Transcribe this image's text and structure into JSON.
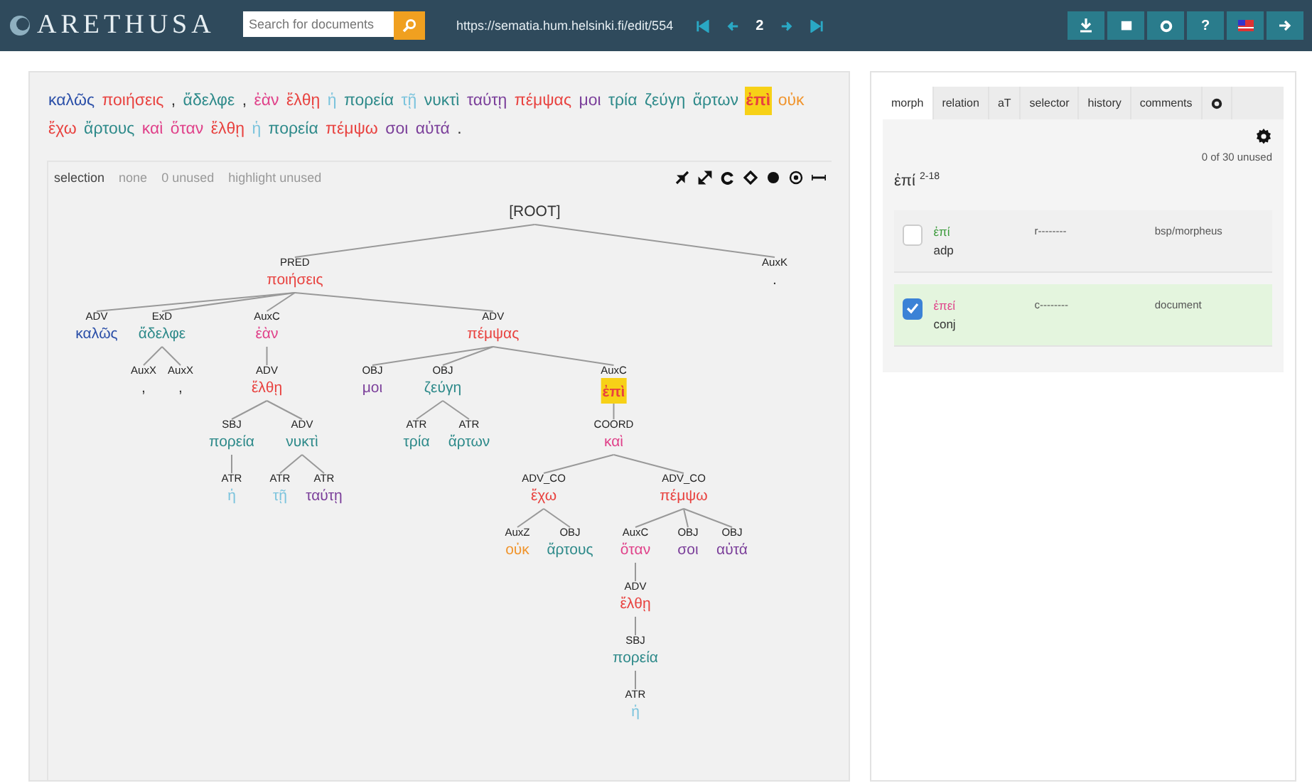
{
  "header": {
    "logo": "ARETHUSA",
    "search": {
      "placeholder": "Search for documents"
    },
    "url": "https://sematia.hum.helsinki.fi/edit/554",
    "page": "2",
    "help": "?"
  },
  "sentence": [
    {
      "text": "καλῶς",
      "color": "#2b4fa8",
      "highlighted": false
    },
    {
      "text": "ποιήσεις",
      "color": "#e8423f",
      "highlighted": false
    },
    {
      "text": ",",
      "color": "#333333",
      "highlighted": false
    },
    {
      "text": "ἄδελφε",
      "color": "#2e8a8a",
      "highlighted": false
    },
    {
      "text": ",",
      "color": "#333333",
      "highlighted": false
    },
    {
      "text": "ἐὰν",
      "color": "#e0428a",
      "highlighted": false
    },
    {
      "text": "ἔλθῃ",
      "color": "#e8423f",
      "highlighted": false
    },
    {
      "text": "ἡ",
      "color": "#7cc4dd",
      "highlighted": false
    },
    {
      "text": "πορεία",
      "color": "#2e8a8a",
      "highlighted": false
    },
    {
      "text": "τῇ",
      "color": "#7cc4dd",
      "highlighted": false
    },
    {
      "text": "νυκτὶ",
      "color": "#2e8a8a",
      "highlighted": false
    },
    {
      "text": "ταύτῃ",
      "color": "#7b3f9a",
      "highlighted": false
    },
    {
      "text": "πέμψας",
      "color": "#e8423f",
      "highlighted": false
    },
    {
      "text": "μοι",
      "color": "#7b3f9a",
      "highlighted": false
    },
    {
      "text": "τρία",
      "color": "#2e8a8a",
      "highlighted": false
    },
    {
      "text": "ζεύγη",
      "color": "#2e8a8a",
      "highlighted": false
    },
    {
      "text": "ἄρτων",
      "color": "#2e8a8a",
      "highlighted": false
    },
    {
      "text": "ἐπὶ",
      "color": "#e8423f",
      "highlighted": true
    },
    {
      "text": "οὐκ",
      "color": "#f0952e",
      "highlighted": false
    },
    {
      "text": "ἔχω",
      "color": "#e8423f",
      "highlighted": false
    },
    {
      "text": "ἄρτους",
      "color": "#2e8a8a",
      "highlighted": false
    },
    {
      "text": "καὶ",
      "color": "#e0428a",
      "highlighted": false
    },
    {
      "text": "ὅταν",
      "color": "#e0428a",
      "highlighted": false
    },
    {
      "text": "ἔλθῃ",
      "color": "#e8423f",
      "highlighted": false
    },
    {
      "text": "ἡ",
      "color": "#7cc4dd",
      "highlighted": false
    },
    {
      "text": "πορεία",
      "color": "#2e8a8a",
      "highlighted": false
    },
    {
      "text": "πέμψω",
      "color": "#e8423f",
      "highlighted": false
    },
    {
      "text": "σοι",
      "color": "#7b3f9a",
      "highlighted": false
    },
    {
      "text": "αὐτά",
      "color": "#7b3f9a",
      "highlighted": false
    },
    {
      "text": ".",
      "highlighted": false
    }
  ],
  "tree_toolbar": {
    "title": "selection",
    "links": [
      "none",
      "0 unused",
      "highlight unused"
    ]
  },
  "tree": {
    "word": "[ROOT]",
    "color": "#333333",
    "highlighted": false,
    "children": [
      {
        "relation": "PRED",
        "word": "ποιήσεις",
        "color": "#e8423f",
        "highlighted": false,
        "children": [
          {
            "relation": "ADV",
            "word": "καλῶς",
            "color": "#2b4fa8",
            "highlighted": false
          },
          {
            "relation": "ExD",
            "word": "ἄδελφε",
            "color": "#2e8a8a",
            "highlighted": false,
            "children": [
              {
                "relation": "AuxX",
                "word": ",",
                "color": "#333333",
                "highlighted": false
              },
              {
                "relation": "AuxX",
                "word": ",",
                "color": "#333333",
                "highlighted": false
              }
            ]
          },
          {
            "relation": "AuxC",
            "word": "ἐὰν",
            "color": "#e0428a",
            "highlighted": false,
            "children": [
              {
                "relation": "ADV",
                "word": "ἔλθῃ",
                "color": "#e8423f",
                "highlighted": false,
                "children": [
                  {
                    "relation": "SBJ",
                    "word": "πορεία",
                    "color": "#2e8a8a",
                    "highlighted": false,
                    "children": [
                      {
                        "relation": "ATR",
                        "word": "ἡ",
                        "color": "#7cc4dd",
                        "highlighted": false
                      }
                    ]
                  },
                  {
                    "relation": "ADV",
                    "word": "νυκτὶ",
                    "color": "#2e8a8a",
                    "highlighted": false,
                    "children": [
                      {
                        "relation": "ATR",
                        "word": "τῇ",
                        "color": "#7cc4dd",
                        "highlighted": false
                      },
                      {
                        "relation": "ATR",
                        "word": "ταύτῃ",
                        "color": "#7b3f9a",
                        "highlighted": false
                      }
                    ]
                  }
                ]
              }
            ]
          },
          {
            "relation": "ADV",
            "word": "πέμψας",
            "color": "#e8423f",
            "highlighted": false,
            "children": [
              {
                "relation": "OBJ",
                "word": "μοι",
                "color": "#7b3f9a",
                "highlighted": false
              },
              {
                "relation": "OBJ",
                "word": "ζεύγη",
                "color": "#2e8a8a",
                "highlighted": false,
                "children": [
                  {
                    "relation": "ATR",
                    "word": "τρία",
                    "color": "#2e8a8a",
                    "highlighted": false
                  },
                  {
                    "relation": "ATR",
                    "word": "ἄρτων",
                    "color": "#2e8a8a",
                    "highlighted": false
                  }
                ]
              },
              {
                "relation": "AuxC",
                "word": "ἐπὶ",
                "color": "#e8423f",
                "highlighted": true,
                "children": [
                  {
                    "relation": "COORD",
                    "word": "καὶ",
                    "color": "#e0428a",
                    "highlighted": false,
                    "children": [
                      {
                        "relation": "ADV_CO",
                        "word": "ἔχω",
                        "color": "#e8423f",
                        "highlighted": false,
                        "children": [
                          {
                            "relation": "AuxZ",
                            "word": "οὐκ",
                            "color": "#f0952e",
                            "highlighted": false
                          },
                          {
                            "relation": "OBJ",
                            "word": "ἄρτους",
                            "color": "#2e8a8a",
                            "highlighted": false
                          }
                        ]
                      },
                      {
                        "relation": "ADV_CO",
                        "word": "πέμψω",
                        "color": "#e8423f",
                        "highlighted": false,
                        "children": [
                          {
                            "relation": "AuxC",
                            "word": "ὅταν",
                            "color": "#e0428a",
                            "highlighted": false,
                            "children": [
                              {
                                "relation": "ADV",
                                "word": "ἔλθῃ",
                                "color": "#e8423f",
                                "highlighted": false,
                                "children": [
                                  {
                                    "relation": "SBJ",
                                    "word": "πορεία",
                                    "color": "#2e8a8a",
                                    "highlighted": false,
                                    "children": [
                                      {
                                        "relation": "ATR",
                                        "word": "ἡ",
                                        "color": "#7cc4dd",
                                        "highlighted": false
                                      }
                                    ]
                                  }
                                ]
                              }
                            ]
                          },
                          {
                            "relation": "OBJ",
                            "word": "σοι",
                            "color": "#7b3f9a",
                            "highlighted": false
                          },
                          {
                            "relation": "OBJ",
                            "word": "αὐτά",
                            "color": "#7b3f9a",
                            "highlighted": false
                          }
                        ]
                      }
                    ]
                  }
                ]
              }
            ]
          }
        ]
      },
      {
        "relation": "AuxK",
        "word": ".",
        "highlighted": false
      }
    ]
  },
  "panel": {
    "tabs": [
      {
        "kind": "text",
        "label": "morph",
        "selected": true
      },
      {
        "kind": "text",
        "label": "relation",
        "selected": false
      },
      {
        "kind": "text",
        "label": "aT",
        "selected": false
      },
      {
        "kind": "text",
        "label": "selector",
        "selected": false
      },
      {
        "kind": "text",
        "label": "history",
        "selected": false
      },
      {
        "kind": "text",
        "label": "comments",
        "selected": false
      },
      {
        "kind": "icon",
        "selected": false
      }
    ],
    "unused": "0 of 30 unused",
    "heading": "ἐπί $^{2-18}$",
    "forms": [
      {
        "form": "ἐπί",
        "color": "#3a9a3a",
        "pos": "adp",
        "postag": "r--------",
        "source": "bsp/morpheus",
        "checked": false
      },
      {
        "form": "ἐπεί",
        "color": "#e0428a",
        "pos": "conj",
        "postag": "c--------",
        "source": "document",
        "checked": true
      }
    ]
  }
}
